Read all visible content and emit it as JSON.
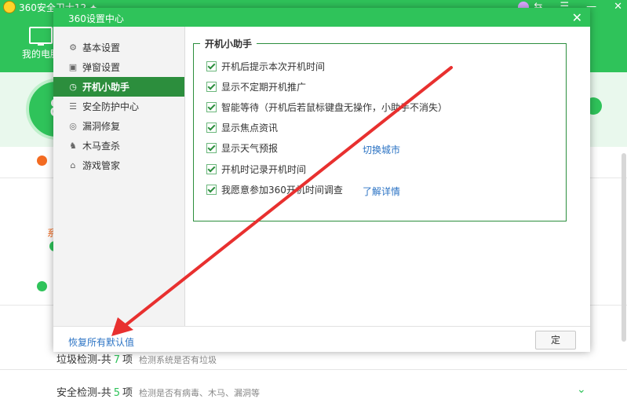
{
  "background_app": {
    "title": "360安全卫士12 ✦",
    "window_controls": [
      "⇆",
      "☰",
      "—",
      "✕"
    ],
    "tab_label": "我的电脑",
    "score_digit": "8",
    "alert_fragment": "系",
    "row1": {
      "label_prefix": "垃圾检测-共",
      "count": "7",
      "label_suffix": "项",
      "desc": "检测系统是否有垃圾"
    },
    "row2": {
      "label_prefix": "安全检测-共",
      "count": "5",
      "label_suffix": "项",
      "desc": "检测是否有病毒、木马、漏洞等"
    }
  },
  "dialog": {
    "title": "360设置中心",
    "close_label": "✕",
    "sidebar": {
      "items": [
        {
          "label": "基本设置",
          "icon": "gear-icon",
          "glyph": "⚙"
        },
        {
          "label": "弹窗设置",
          "icon": "window-icon",
          "glyph": "▣"
        },
        {
          "label": "开机小助手",
          "icon": "clock-icon",
          "glyph": "◷",
          "active": true
        },
        {
          "label": "安全防护中心",
          "icon": "shield-icon",
          "glyph": "☰"
        },
        {
          "label": "漏洞修复",
          "icon": "patch-icon",
          "glyph": "◎"
        },
        {
          "label": "木马查杀",
          "icon": "horse-icon",
          "glyph": "♞"
        },
        {
          "label": "游戏管家",
          "icon": "gamepad-icon",
          "glyph": "⌂"
        }
      ]
    },
    "group_title": "开机小助手",
    "options": [
      {
        "label": "开机后提示本次开机时间",
        "checked": true
      },
      {
        "label": "显示不定期开机推广",
        "checked": true
      },
      {
        "label": "智能等待（开机后若鼠标键盘无操作，小助手不消失）",
        "checked": true
      },
      {
        "label": "显示焦点资讯",
        "checked": true
      },
      {
        "label": "显示天气预报",
        "checked": true
      },
      {
        "label": "开机时记录开机时间",
        "checked": true
      },
      {
        "label": "我愿意参加360开机时间调查",
        "checked": true
      }
    ],
    "links": {
      "switch_city": "切换城市",
      "learn_more": "了解详情"
    },
    "reset_label": "恢复所有默认值",
    "ok_label": "定"
  },
  "annotation": {
    "arrow_color": "#e8302f"
  },
  "colors": {
    "brand_green": "#2fc35a",
    "dark_green": "#2c8e3d",
    "link_blue": "#2b73c4"
  }
}
